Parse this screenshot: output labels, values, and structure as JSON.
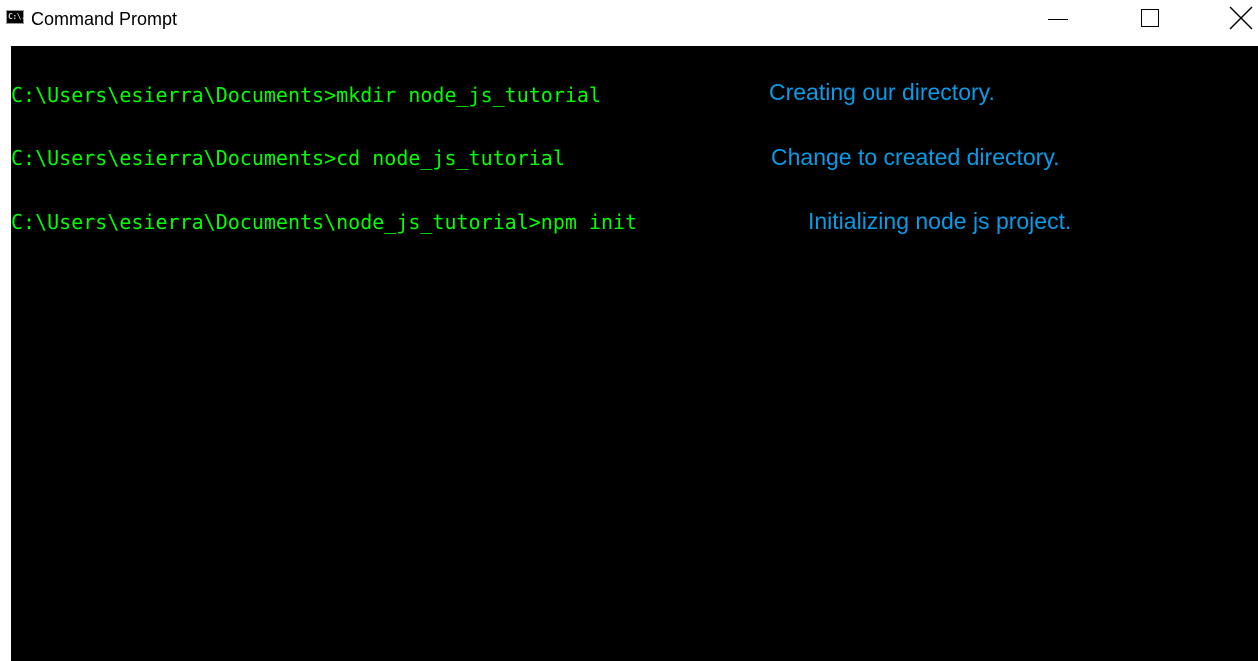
{
  "window": {
    "title": "Command Prompt",
    "icon_label": "C:\\."
  },
  "controls": {
    "minimize_icon": "minimize-icon",
    "maximize_icon": "maximize-icon",
    "close_icon": "close-icon"
  },
  "console": {
    "background": "#000000",
    "command_color": "#00ff00",
    "annotation_color": "#0b9ae6",
    "lines": [
      {
        "command": "C:\\Users\\esierra\\Documents>mkdir node_js_tutorial",
        "annotation": "Creating our directory."
      },
      {
        "command": "C:\\Users\\esierra\\Documents>cd node_js_tutorial",
        "annotation": "Change to created directory."
      },
      {
        "command": "C:\\Users\\esierra\\Documents\\node_js_tutorial>npm init",
        "annotation": "Initializing node js project."
      }
    ]
  }
}
